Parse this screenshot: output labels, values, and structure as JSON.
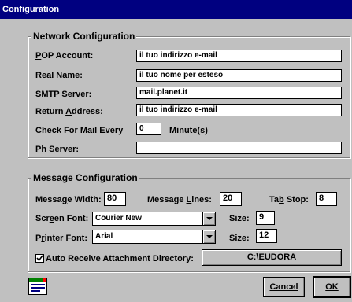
{
  "window": {
    "title": "Configuration"
  },
  "network": {
    "title": "Network Configuration",
    "pop_account": {
      "label": "POP Account:",
      "value": "il tuo indirizzo e-mail"
    },
    "real_name": {
      "label": "Real Name:",
      "value": "il tuo nome per esteso"
    },
    "smtp_server": {
      "label": "SMTP Server:",
      "value": "mail.planet.it"
    },
    "return_address": {
      "label": "Return Address:",
      "value": "il tuo indirizzo e-mail"
    },
    "check_mail": {
      "label": "Check For Mail Every",
      "value": "0",
      "unit": "Minute(s)"
    },
    "ph_server": {
      "label": "Ph Server:",
      "value": ""
    }
  },
  "message": {
    "title": "Message Configuration",
    "message_width": {
      "label": "Message Width:",
      "value": "80"
    },
    "message_lines": {
      "label": "Message Lines:",
      "value": "20"
    },
    "tab_stop": {
      "label": "Tab Stop:",
      "value": "8"
    },
    "screen_font": {
      "label": "Screen Font:",
      "value": "Courier New",
      "size_label": "Size:",
      "size": "9"
    },
    "printer_font": {
      "label": "Printer Font:",
      "value": "Arial",
      "size_label": "Size:",
      "size": "12"
    },
    "auto_receive": {
      "label": "Auto Receive Attachment Directory:",
      "checked": true,
      "button": "C:\\EUDORA"
    }
  },
  "buttons": {
    "cancel": "Cancel",
    "ok": "OK"
  },
  "icon": "document-settings-icon"
}
